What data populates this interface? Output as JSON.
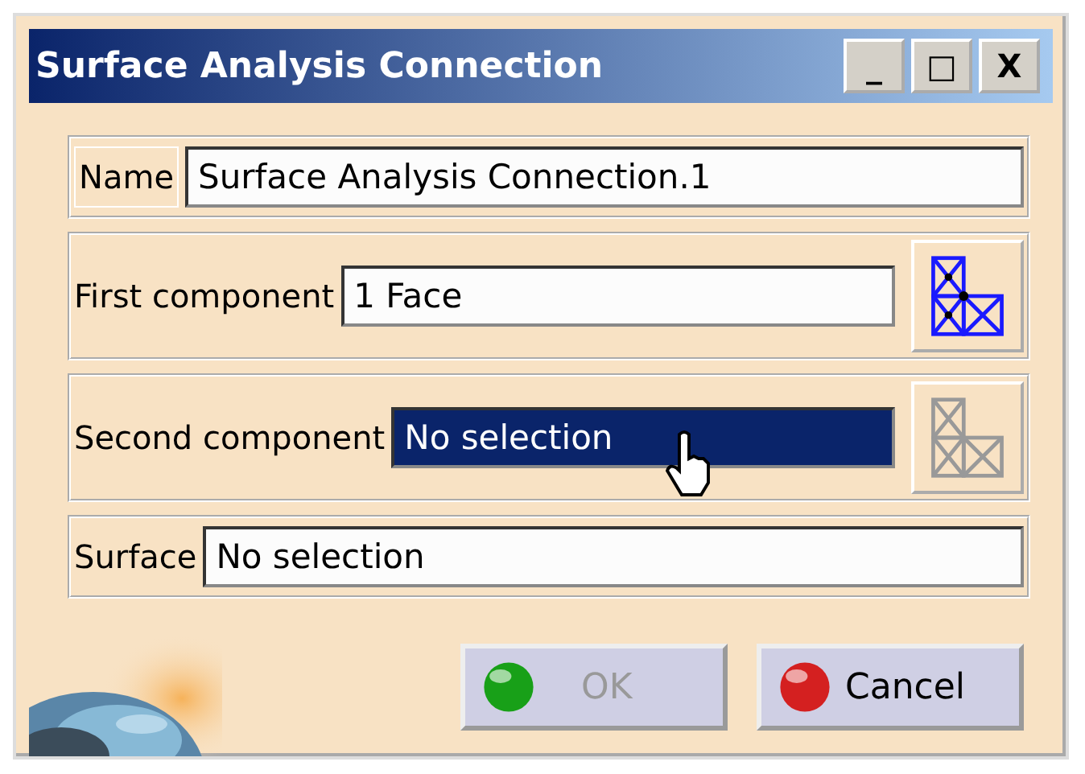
{
  "window": {
    "title": "Surface Analysis Connection",
    "controls": [
      "_",
      "□",
      "X"
    ]
  },
  "rows": [
    {
      "kind": "text",
      "label": "Name",
      "value": "Surface Analysis Connection.1",
      "selected": false
    },
    {
      "kind": "selector",
      "label": "First component",
      "value": "1 Face",
      "selected": false,
      "disabled": false
    },
    {
      "kind": "selector",
      "label": "Second component",
      "value": "No selection",
      "selected": true,
      "disabled": true
    },
    {
      "kind": "text",
      "label": "Surface",
      "value": "No selection",
      "selected": false
    }
  ],
  "buttons": [
    {
      "kind": "ok",
      "label": "OK",
      "disabled": true
    },
    {
      "kind": "cancel",
      "label": "Cancel",
      "disabled": false
    }
  ]
}
